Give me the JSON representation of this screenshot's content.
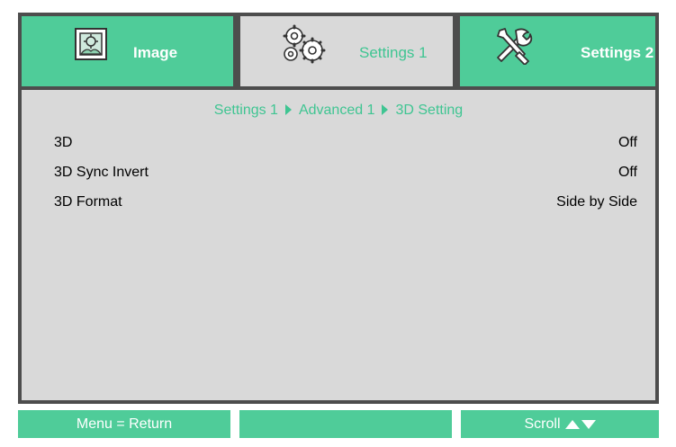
{
  "tabs": [
    {
      "label": "Image",
      "icon": "image-icon",
      "active": false
    },
    {
      "label": "Settings 1",
      "icon": "gears-icon",
      "active": true
    },
    {
      "label": "Settings 2",
      "icon": "tools-icon",
      "active": false
    }
  ],
  "breadcrumb": [
    "Settings 1",
    "Advanced 1",
    "3D Setting"
  ],
  "settings": [
    {
      "label": "3D",
      "value": "Off"
    },
    {
      "label": "3D Sync Invert",
      "value": "Off"
    },
    {
      "label": "3D Format",
      "value": "Side by Side"
    }
  ],
  "footer": {
    "menu_hint": "Menu = Return",
    "middle": "",
    "scroll_hint": "Scroll"
  },
  "colors": {
    "accent_green": "#4fcc99",
    "active_tab_text": "#3fc592",
    "panel_gray": "#d9d9d9",
    "border_dark": "#4d4d4d"
  }
}
